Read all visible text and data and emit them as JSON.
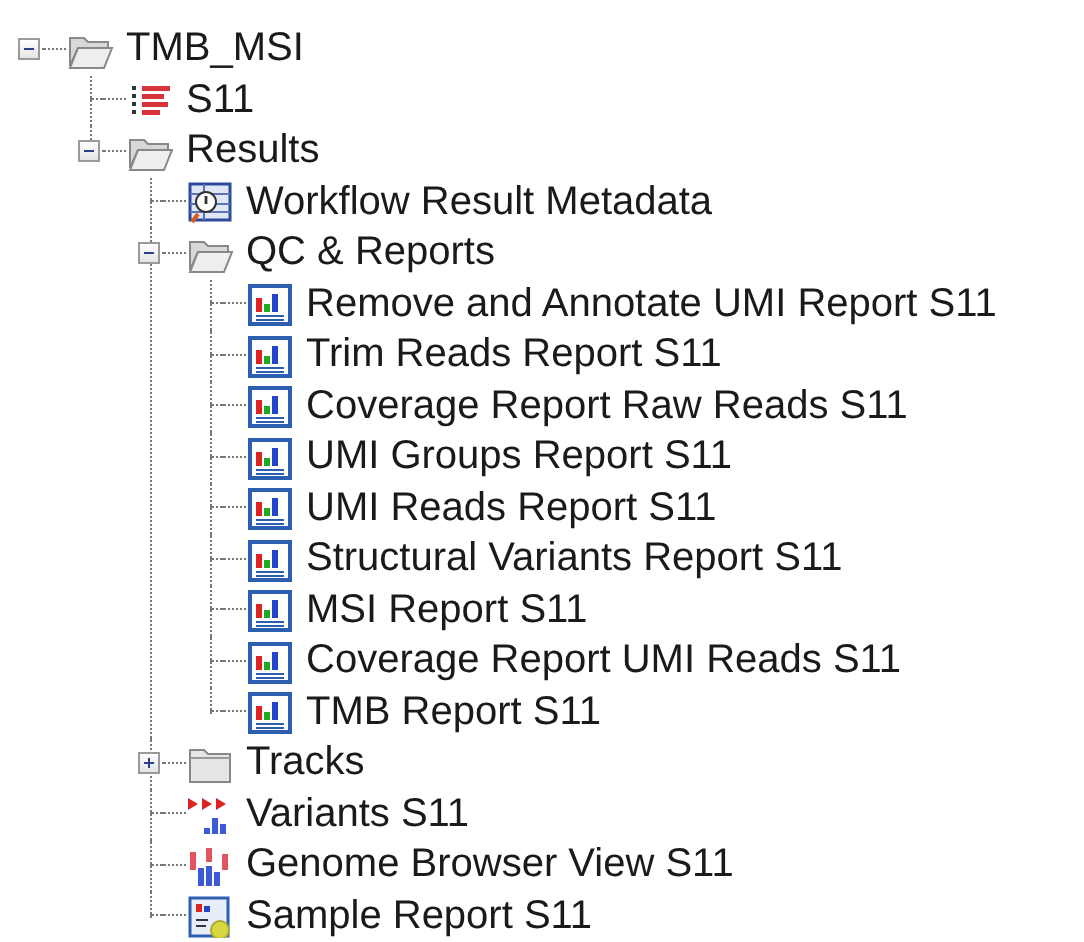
{
  "tree": [
    {
      "label": "TMB_MSI",
      "kind": "folder",
      "expanded": true,
      "children": [
        {
          "label": "S11",
          "kind": "sequence"
        },
        {
          "label": "Results",
          "kind": "folder",
          "expanded": true,
          "children": [
            {
              "label": "Workflow Result Metadata",
              "kind": "metadata"
            },
            {
              "label": "QC & Reports",
              "kind": "folder",
              "expanded": true,
              "children": [
                {
                  "label": "Remove and Annotate UMI Report S11",
                  "kind": "report"
                },
                {
                  "label": "Trim Reads Report S11",
                  "kind": "report"
                },
                {
                  "label": "Coverage Report Raw Reads S11",
                  "kind": "report"
                },
                {
                  "label": "UMI Groups Report S11",
                  "kind": "report"
                },
                {
                  "label": "UMI Reads Report S11",
                  "kind": "report"
                },
                {
                  "label": "Structural Variants Report S11",
                  "kind": "report"
                },
                {
                  "label": "MSI Report S11",
                  "kind": "report"
                },
                {
                  "label": "Coverage Report UMI Reads S11",
                  "kind": "report"
                },
                {
                  "label": "TMB Report S11",
                  "kind": "report"
                }
              ]
            },
            {
              "label": "Tracks",
              "kind": "folder",
              "expanded": false
            },
            {
              "label": "Variants S11",
              "kind": "variants"
            },
            {
              "label": "Genome Browser View S11",
              "kind": "browser"
            },
            {
              "label": "Sample Report S11",
              "kind": "sample"
            }
          ]
        }
      ]
    }
  ]
}
